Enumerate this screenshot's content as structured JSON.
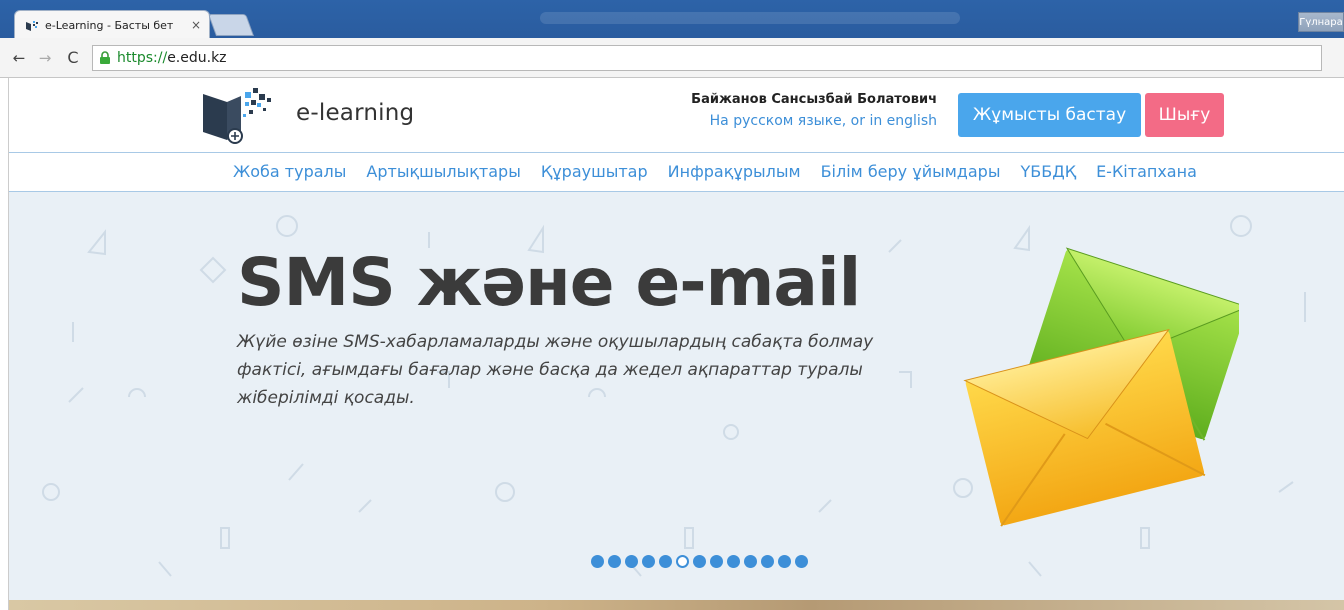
{
  "browser": {
    "tab_title": "e-Learning - Басты бет",
    "tab_close": "×",
    "profile_label": "Гүлнара",
    "back_glyph": "←",
    "forward_glyph": "→",
    "reload_glyph": "C",
    "url_scheme": "https://",
    "url_host": "e.edu.kz"
  },
  "header": {
    "logo_text": "e-learning",
    "user_name": "Байжанов Сансызбай Болатович",
    "lang_links": "На русском языке, or in english",
    "start_button": "Жұмысты бастау",
    "logout_button": "Шығу"
  },
  "nav": {
    "items": [
      "Жоба туралы",
      "Артықшылықтары",
      "Құраушытар",
      "Инфрақұрылым",
      "Білім беру ұйымдары",
      "ҮББДҚ",
      "Е-Кітапхана"
    ]
  },
  "hero": {
    "title": "SMS және e-mail",
    "text": "Жүйе өзіне SMS-хабарламаларды және оқушылардың сабақта болмау фактісі, ағымдағы бағалар және басқа да жедел ақпараттар туралы жіберілімді қосады.",
    "slide_count": 13,
    "active_slide": 6
  },
  "colors": {
    "accent": "#3d8fd8",
    "start_button": "#4aa6ec",
    "logout_button": "#f36b86",
    "hero_bg": "#e9f0f6"
  }
}
